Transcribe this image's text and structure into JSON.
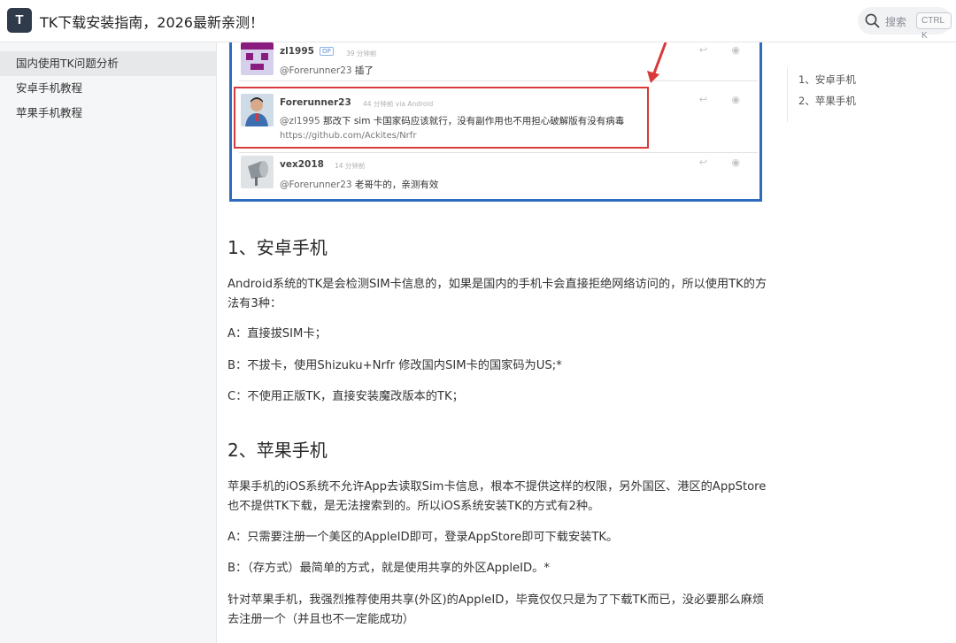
{
  "header": {
    "logo_letter": "T",
    "title": "TK下载安装指南，2026最新亲测！",
    "search_label": "搜索",
    "search_shortcut": "CTRL K"
  },
  "sidebar": {
    "items": [
      {
        "label": "国内使用TK问题分析",
        "active": true
      },
      {
        "label": "安卓手机教程",
        "active": false
      },
      {
        "label": "苹果手机教程",
        "active": false
      }
    ]
  },
  "screenshot": {
    "comments": [
      {
        "user": "zl1995",
        "badge": "OP",
        "time": "39 分钟前",
        "mention": "@Forerunner23",
        "text": " 插了",
        "link": ""
      },
      {
        "user": "Forerunner23",
        "badge": "",
        "time": "44 分钟前 via Android",
        "mention": "@zl1995",
        "text": " 那改下 sim 卡国家码应该就行，没有副作用也不用担心破解版有没有病毒",
        "link": "https://github.com/Ackites/Nrfr"
      },
      {
        "user": "vex2018",
        "badge": "",
        "time": "14 分钟前",
        "mention": "@Forerunner23",
        "text": " 老哥牛的，亲测有效",
        "link": ""
      }
    ],
    "highlight_color": "#d9393a",
    "border_color": "#2d6bc0"
  },
  "content": {
    "h_android": "1、安卓手机",
    "android_p1": "Android系统的TK是会检测SIM卡信息的，如果是国内的手机卡会直接拒绝网络访问的，所以使用TK的方法有3种：",
    "android_a": "A：直接拔SIM卡；",
    "android_b": "B：不拔卡，使用Shizuku+Nrfr 修改国内SIM卡的国家码为US;*",
    "android_c": "C：不使用正版TK，直接安装魔改版本的TK；",
    "h_apple": "2、苹果手机",
    "apple_p1": "苹果手机的iOS系统不允许App去读取Sim卡信息，根本不提供这样的权限，另外国区、港区的AppStore也不提供TK下载，是无法搜索到的。所以iOS系统安装TK的方式有2种。",
    "apple_a": "A：只需要注册一个美区的AppleID即可，登录AppStore即可下载安装TK。",
    "apple_b": "B：（存方式）最简单的方式，就是使用共享的外区AppleID。*",
    "apple_p2": "针对苹果手机，我强烈推荐使用共享(外区)的AppleID，毕竟仅仅只是为了下载TK而已，没必要那么麻烦去注册一个（并且也不一定能成功）"
  },
  "toc": {
    "items": [
      "1、安卓手机",
      "2、苹果手机"
    ]
  }
}
